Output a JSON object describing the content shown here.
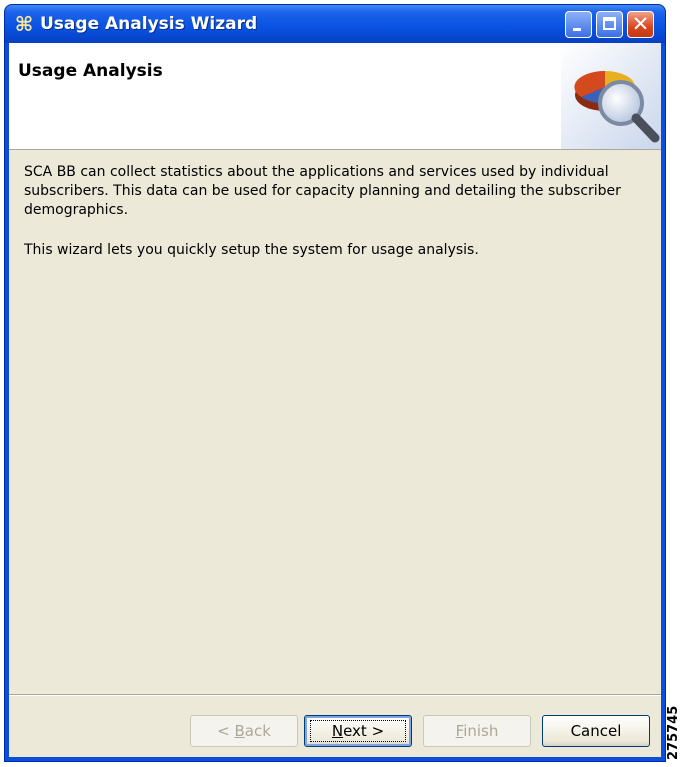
{
  "window": {
    "title": "Usage Analysis Wizard",
    "controls": {
      "close_glyph": "✕"
    }
  },
  "banner": {
    "title": "Usage Analysis",
    "image_icon": "pie-chart-magnifier-icon"
  },
  "description": {
    "paragraph1": "SCA BB can collect statistics about the applications and services used by individual subscribers. This data can be used for capacity planning and detailing the subscriber demographics.",
    "paragraph2": "This wizard lets you quickly setup the system for usage analysis."
  },
  "buttons": {
    "back": {
      "label_pre": "< ",
      "mnemonic": "B",
      "label_post": "ack",
      "enabled": false
    },
    "next": {
      "mnemonic": "N",
      "label_post": "ext >",
      "enabled": true
    },
    "finish": {
      "mnemonic": "F",
      "label_post": "inish",
      "enabled": false
    },
    "cancel": {
      "label": "Cancel",
      "enabled": true
    }
  },
  "figure_id": "275745",
  "colors": {
    "titlebar": "#0a54e3",
    "dialog_bg": "#ece9d8",
    "close_button": "#d9461e"
  }
}
